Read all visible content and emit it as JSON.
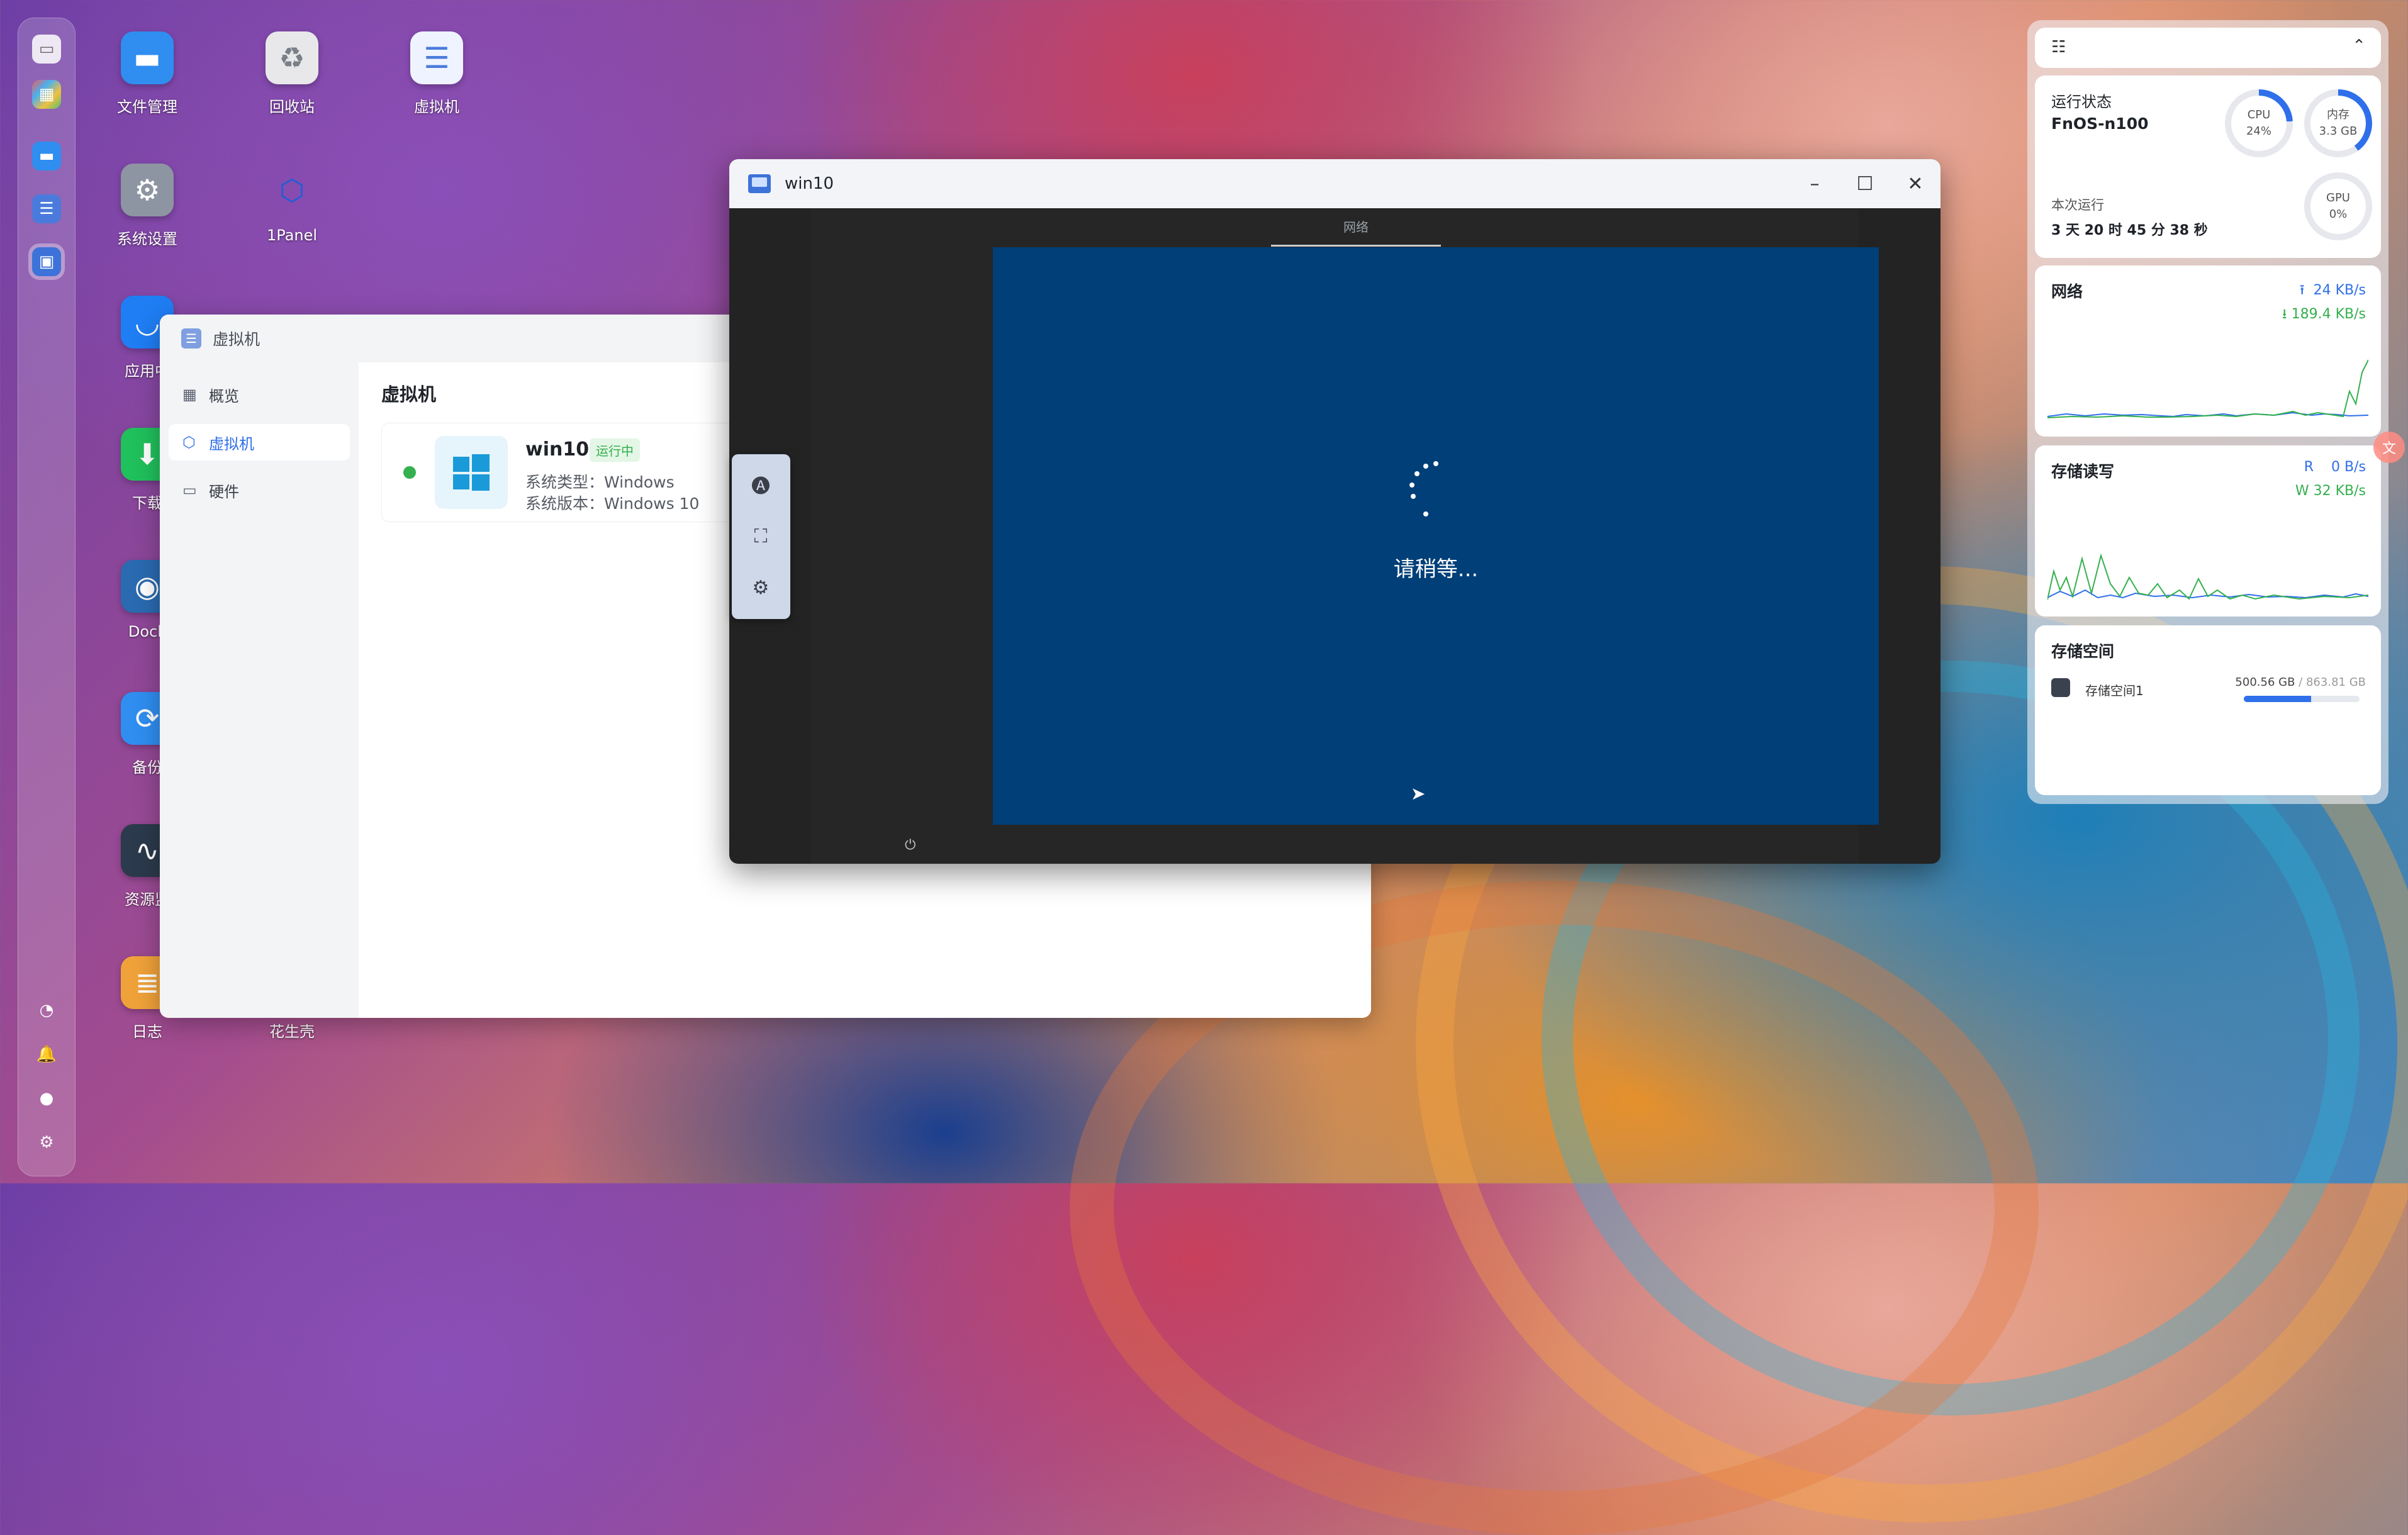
{
  "desktop": {
    "icons": [
      {
        "label": "文件管理",
        "icon": "folder-icon",
        "color": "#2f8ef0"
      },
      {
        "label": "回收站",
        "icon": "recycle-bin-icon",
        "color": "#dcdcdc"
      },
      {
        "label": "虚拟机",
        "icon": "vm-icon",
        "color": "#4a7bdc"
      },
      {
        "label": "系统设置",
        "icon": "gear-icon",
        "color": "#8d95a3"
      },
      {
        "label": "1Panel",
        "icon": "1panel-icon",
        "color": "#ffffff"
      },
      {
        "label": "应用中",
        "icon": "app-store-icon",
        "color": "#1f7ef4"
      },
      {
        "label": "下载",
        "icon": "download-icon",
        "color": "#20c05c"
      },
      {
        "label": "Dock",
        "icon": "docker-icon",
        "color": "#2a6ab0"
      },
      {
        "label": "备份",
        "icon": "backup-icon",
        "color": "#2f8ef0"
      },
      {
        "label": "资源监",
        "icon": "monitor-icon",
        "color": "#2b3a4c"
      },
      {
        "label": "日志",
        "icon": "log-icon",
        "color": "#f0a23a"
      },
      {
        "label": "花生壳",
        "icon": "peanut-shell-icon",
        "color": "#f05a28"
      }
    ]
  },
  "vm_window": {
    "title": "虚拟机",
    "nav": [
      {
        "label": "概览",
        "icon": "grid-icon"
      },
      {
        "label": "虚拟机",
        "icon": "cube-icon"
      },
      {
        "label": "硬件",
        "icon": "hardware-icon"
      }
    ],
    "main_title": "虚拟机",
    "vm": {
      "name": "win10",
      "status": "运行中",
      "type_line": "系统类型：Windows",
      "version_line": "系统版本：Windows 10"
    }
  },
  "console_window": {
    "title": "win10",
    "tab": "网络",
    "loading_text": "请稍等..."
  },
  "widgets": {
    "status": {
      "title": "运行状态",
      "host": "FnOS-n100",
      "uptime_label": "本次运行",
      "uptime": "3 天 20 时 45 分 38 秒",
      "cpu_label": "CPU",
      "cpu_value": "24%",
      "cpu_percent": 24,
      "mem_label": "内存",
      "mem_value": "3.3 GB",
      "mem_percent": 40,
      "gpu_label": "GPU",
      "gpu_value": "0%",
      "gpu_percent": 0
    },
    "network": {
      "title": "网络",
      "up": "24 KB/s",
      "down": "189.4 KB/s"
    },
    "disk_io": {
      "title": "存储读写",
      "read_label": "R",
      "read": "0 B/s",
      "write_label": "W",
      "write": "32 KB/s"
    },
    "storage": {
      "title": "存储空间",
      "name": "存储空间1",
      "used": "500.56 GB",
      "sep": "/",
      "total": "863.81 GB",
      "used_fraction": 0.58
    }
  },
  "colors": {
    "accent": "#2f6fea",
    "running": "#35b04e",
    "vm_screen": "#003f78"
  }
}
